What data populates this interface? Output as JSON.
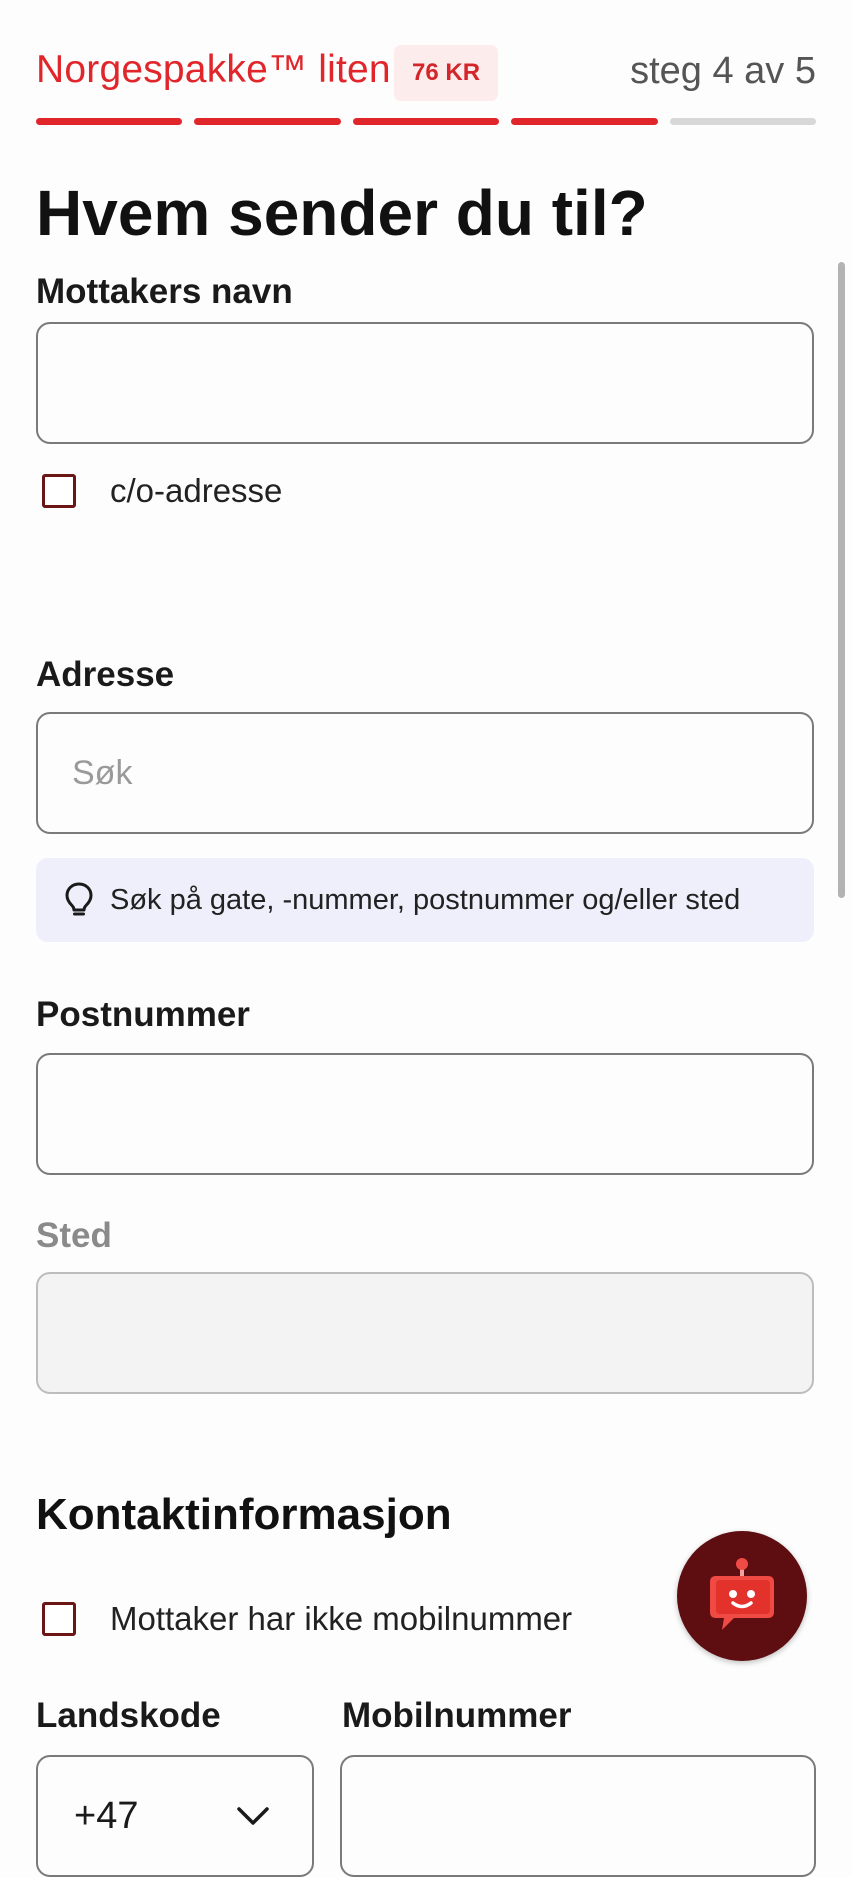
{
  "header": {
    "product_name": "Norgespakke™ liten",
    "price": "76 KR",
    "step": "steg 4 av 5",
    "progress": {
      "completed_steps": 4,
      "total_steps": 5
    }
  },
  "title": "Hvem sender du til?",
  "recipient": {
    "name_label": "Mottakers navn",
    "name_value": "",
    "co_label": "c/o-adresse",
    "co_checked": false
  },
  "address": {
    "label": "Adresse",
    "placeholder": "Søk",
    "hint": "Søk på gate, -nummer, postnummer og/eller sted",
    "hint_icon": "lightbulb-icon"
  },
  "postcode": {
    "label": "Postnummer",
    "value": ""
  },
  "place": {
    "label": "Sted",
    "value": "",
    "disabled": true
  },
  "contact": {
    "title": "Kontaktinformasjon",
    "no_mobile_label": "Mottaker har ikke mobilnummer",
    "no_mobile_checked": false,
    "country_code_label": "Landskode",
    "country_code_value": "+47",
    "mobile_label": "Mobilnummer",
    "mobile_value": ""
  },
  "chat": {
    "icon": "chatbot-icon"
  },
  "colors": {
    "brand_red": "#e0262b",
    "chat_bg": "#5e0d10",
    "hint_bg": "#efeffc"
  }
}
